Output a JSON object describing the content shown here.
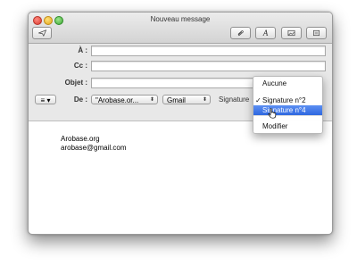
{
  "window": {
    "title": "Nouveau message"
  },
  "toolbar": {
    "format_glyph": "A"
  },
  "fields": {
    "to_label": "À :",
    "cc_label": "Cc :",
    "subject_label": "Objet :",
    "to_value": "",
    "cc_value": "",
    "subject_value": ""
  },
  "from_row": {
    "list_button": "≡ ▾",
    "from_label": "De :",
    "from_value": "\"Arobase.or...",
    "account_value": "Gmail",
    "signature_label": "Signature"
  },
  "signature_menu": {
    "items": [
      "Aucune",
      "Signature n°2",
      "Signature n°4",
      "Modifier"
    ],
    "checked": "✓"
  },
  "message": {
    "line1": "Arobase.org",
    "line2": "arobase@gmail.com"
  },
  "colors": {
    "menu_highlight": "#2f68e0"
  }
}
